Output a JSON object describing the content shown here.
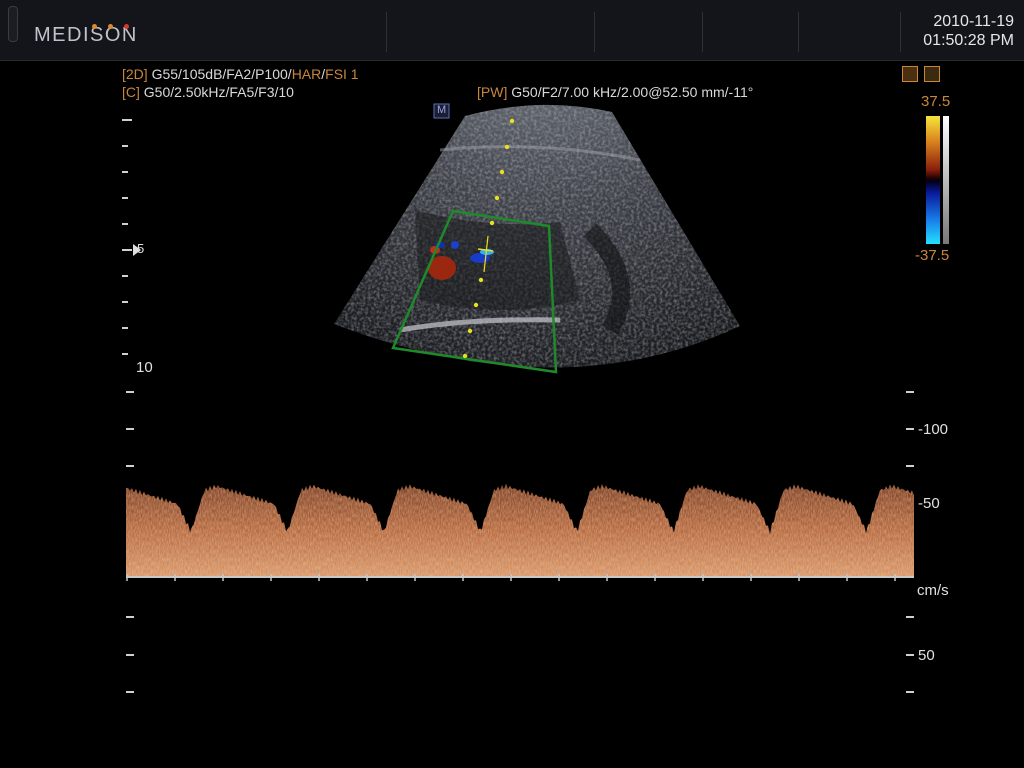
{
  "header": {
    "logo": "MEDISON",
    "date": "2010-11-19",
    "time": "01:50:28 PM"
  },
  "params": {
    "line2d_tag": "[2D]",
    "line2d_a": " G55/105dB/FA2/P100/",
    "line2d_har": "HAR",
    "line2d_sep": "/",
    "line2d_fsi": "FSI 1",
    "linec_tag": "[C]",
    "linec_rest": " G50/2.50kHz/FA5/F3/10",
    "linepw_tag": "[PW]",
    "linepw_rest": " G50/F2/7.00 kHz/2.00@52.50 mm/-11°"
  },
  "image": {
    "marker": "M",
    "depth_mid": "5",
    "depth_bottom": "10"
  },
  "colorbar": {
    "top": "37.5",
    "bottom": "-37.5"
  },
  "doppler": {
    "scale_labels": [
      "-100",
      "-50",
      "cm/s",
      "50"
    ]
  },
  "colors": {
    "accent": "#c9863b",
    "roi_box": "#1e8a2a",
    "cursor": "#e8e020"
  }
}
